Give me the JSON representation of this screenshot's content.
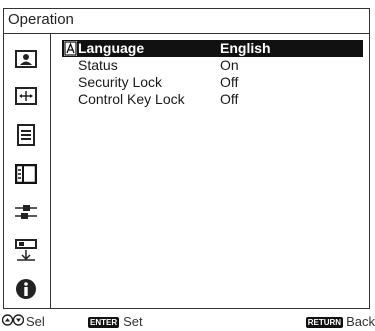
{
  "window": {
    "title": "Operation"
  },
  "sidebar": {
    "icons": [
      "picture-icon",
      "screen-icon",
      "setup-icon",
      "function-icon",
      "connection-icon",
      "installation-icon",
      "information-icon"
    ],
    "selected_index": 3
  },
  "menu": {
    "items": [
      {
        "label": "Language",
        "value": "English"
      },
      {
        "label": "Status",
        "value": "On"
      },
      {
        "label": "Security Lock",
        "value": "Off"
      },
      {
        "label": "Control Key Lock",
        "value": "Off"
      }
    ]
  },
  "footer": {
    "select_label": "Sel",
    "enter_key": "ENTER",
    "set_label": "Set",
    "return_key": "RETURN",
    "back_label": "Back"
  }
}
